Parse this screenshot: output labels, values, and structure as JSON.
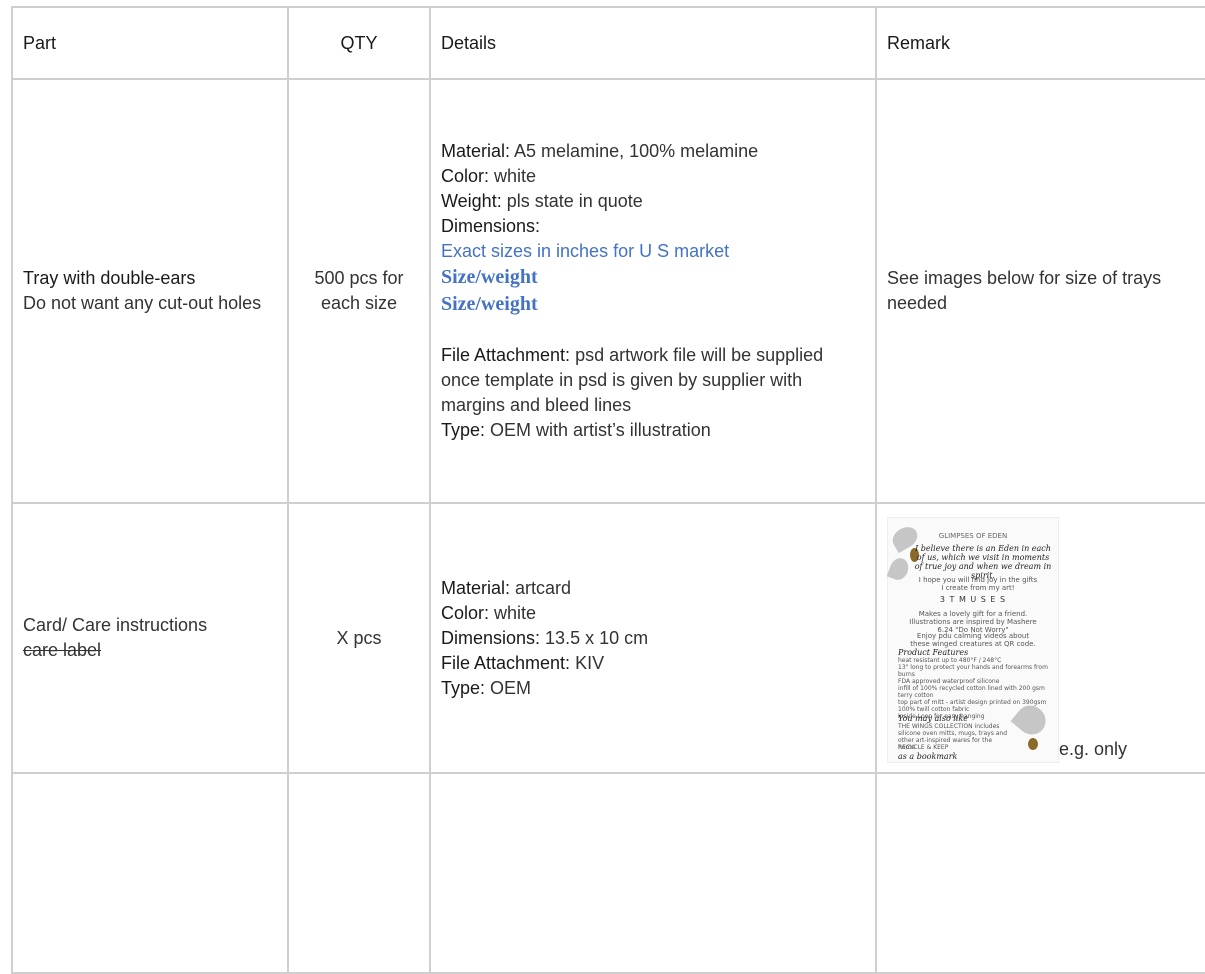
{
  "headers": {
    "part": "Part",
    "qty": "QTY",
    "details": "Details",
    "remark": "Remark"
  },
  "rows": [
    {
      "part_title": "Tray with double-ears",
      "part_note": "Do not want any cut-out holes",
      "qty": "500 pcs for each size",
      "details": {
        "material_label": "Material:",
        "material_value": " A5 melamine, 100% melamine",
        "color_label": "Color:",
        "color_value": " white",
        "weight_label": "Weight:",
        "weight_value": " pls state in quote",
        "dimensions_label": "Dimensions:",
        "sizes_line": "Exact sizes in inches for U S market",
        "size_weight_1": "Size/weight",
        "size_weight_2": "Size/weight",
        "file_label": "File Attachment:",
        "file_value": " psd artwork file will be supplied once template in psd is given by supplier with margins and bleed lines",
        "type_label": "Type:",
        "type_value": " OEM with artist’s illustration"
      },
      "remark": "See images below for size of trays needed"
    },
    {
      "part_title": "Card/ Care instructions",
      "part_strike": "care label",
      "qty": "X pcs",
      "details": {
        "material_label": "Material:",
        "material_value": " artcard",
        "color_label": "Color:",
        "color_value": " white",
        "dimensions_label": "Dimensions:",
        "dimensions_value": " 13.5 x 10 cm",
        "file_label": "File Attachment:",
        "file_value": " KIV",
        "type_label": "Type:",
        "type_value": " OEM"
      },
      "remark_note": "e.g. only",
      "card_image": {
        "title": "GLIMPSES OF EDEN",
        "quote": "I believe there is an Eden in each of us, which we visit in moments of true joy and when we dream in spirit.",
        "hope": "I hope you will find joy in the gifts I create from my art!",
        "brand": "3 T M U S E S",
        "gift": "Makes a lovely gift for a friend. Illustrations are inspired by Mashere 6.24 \"Do Not Worry\"",
        "video": "Enjoy pdu calming videos about these winged creatures at QR code.",
        "features_title": "Product Features",
        "features": [
          "heat resistant up to 480°F / 248°C",
          "13\" long to protect your hands and forearms from burns",
          "FDA approved waterproof silicone",
          "infill of 100% recycled cotton lined with 200 gsm terry cotton",
          "top part of mitt - artist design printed on 390gsm 100% twill cotton fabric",
          "Inside Loop for easy hanging"
        ],
        "also_like": "You may also like",
        "collection": "THE WINGS COLLECTION includes silicone oven mitts, mugs, trays and other art-inspired wares for the home",
        "recycle": "RECYCLE & KEEP",
        "bookmark": "as a bookmark"
      }
    }
  ]
}
